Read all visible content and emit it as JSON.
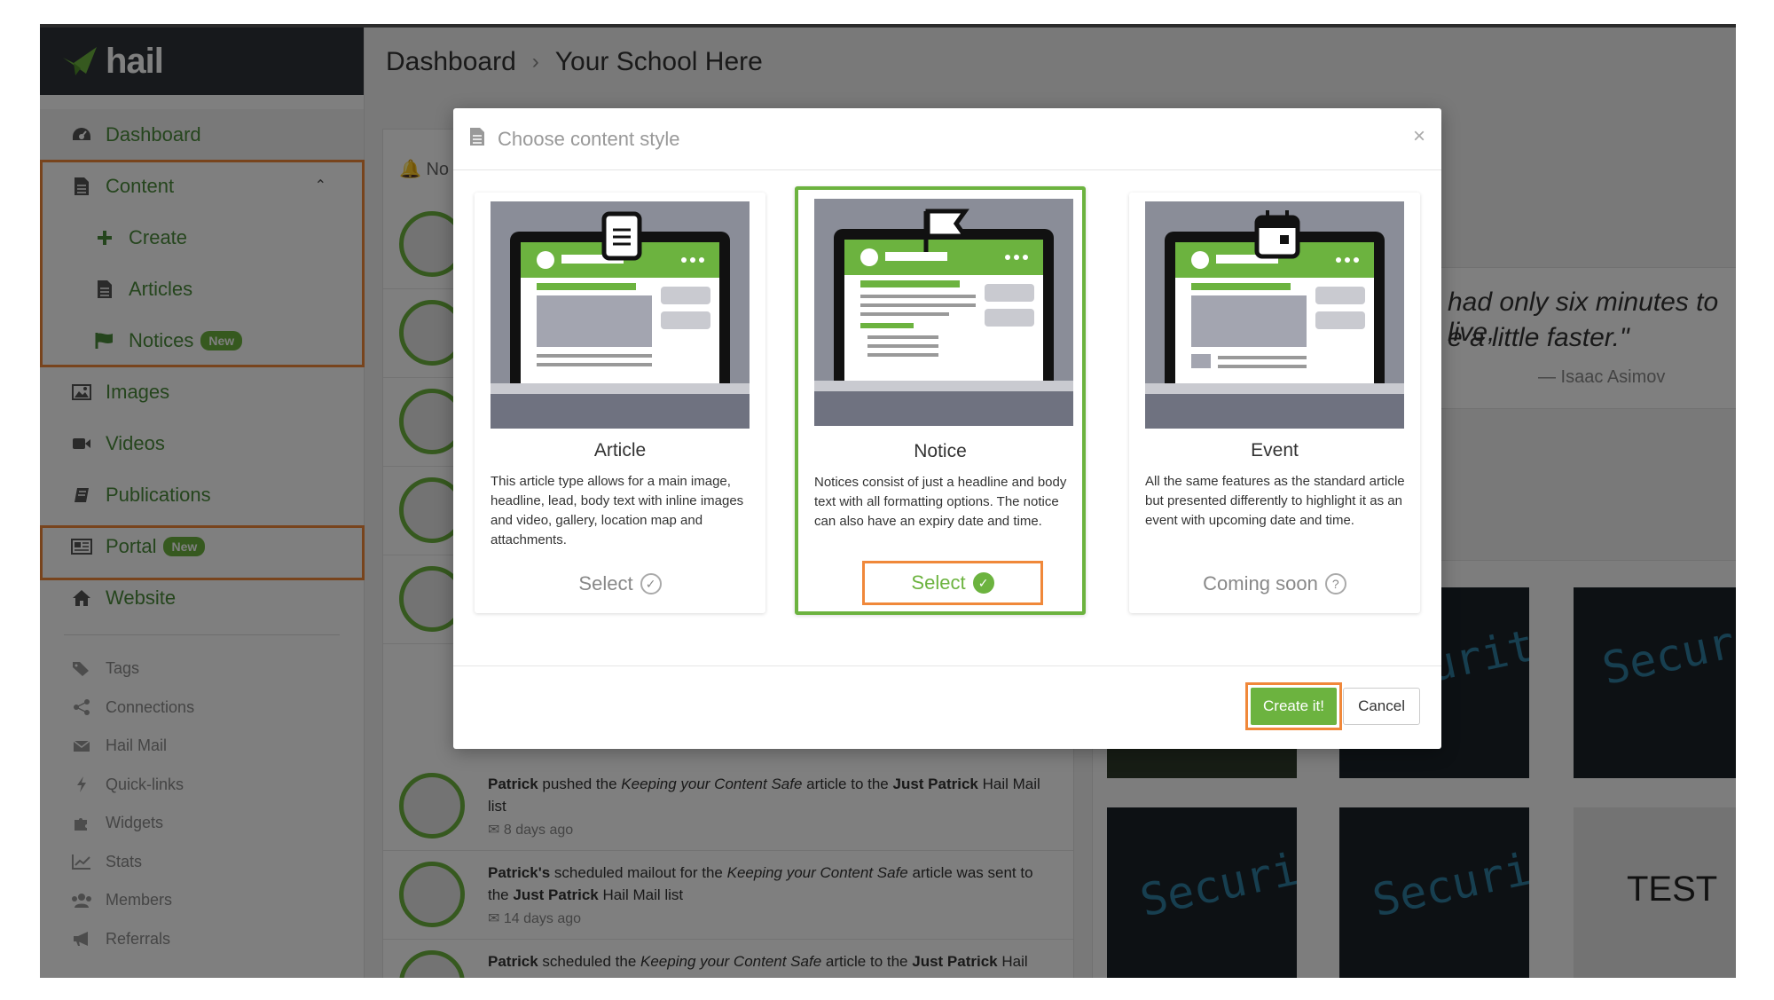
{
  "brand": {
    "name": "hail",
    "accent": "#6cb33f",
    "highlight": "#f0883a"
  },
  "sidebar": {
    "items": [
      {
        "label": "Dashboard",
        "icon": "dashboard-icon"
      },
      {
        "label": "Content",
        "icon": "document-icon"
      },
      {
        "label": "Create",
        "icon": "plus-icon"
      },
      {
        "label": "Articles",
        "icon": "document-icon"
      },
      {
        "label": "Notices",
        "icon": "flag-icon",
        "badge": "New"
      },
      {
        "label": "Images",
        "icon": "image-icon"
      },
      {
        "label": "Videos",
        "icon": "video-icon"
      },
      {
        "label": "Publications",
        "icon": "book-icon"
      },
      {
        "label": "Portal",
        "icon": "newspaper-icon",
        "badge": "New"
      },
      {
        "label": "Website",
        "icon": "home-icon"
      }
    ],
    "secondary": [
      {
        "label": "Tags",
        "icon": "tags-icon"
      },
      {
        "label": "Connections",
        "icon": "share-icon"
      },
      {
        "label": "Hail Mail",
        "icon": "envelope-icon"
      },
      {
        "label": "Quick-links",
        "icon": "bolt-icon"
      },
      {
        "label": "Widgets",
        "icon": "puzzle-icon"
      },
      {
        "label": "Stats",
        "icon": "chart-icon"
      },
      {
        "label": "Members",
        "icon": "users-icon"
      },
      {
        "label": "Referrals",
        "icon": "megaphone-icon"
      }
    ]
  },
  "breadcrumb": {
    "root": "Dashboard",
    "current": "Your School Here"
  },
  "background": {
    "feed_header": "No",
    "quote_line1": "had only six minutes to live,",
    "quote_line2": "e a little faster.\"",
    "quote_author": "— Isaac Asimov",
    "tile_words": [
      "curity",
      "Secur",
      "Security",
      "Security",
      "TEST"
    ],
    "feed": [
      {
        "actor": "Patrick",
        "t1": " pushed the ",
        "em": "Keeping your Content Safe",
        "t2": " article to the ",
        "target": "Just Patrick",
        "t3": " Hail Mail list",
        "time": "8 days ago"
      },
      {
        "actor": "Patrick's",
        "t1": " scheduled mailout for the ",
        "em": "Keeping your Content Safe",
        "t2": " article was sent to the ",
        "target": "Just Patrick",
        "t3": " Hail Mail list",
        "time": "14 days ago"
      },
      {
        "actor": "Patrick",
        "t1": " scheduled the ",
        "em": "Keeping your Content Safe",
        "t2": " article to the ",
        "target": "Just Patrick",
        "t3": " Hail Mail list",
        "time": ""
      }
    ]
  },
  "modal": {
    "title": "Choose content style",
    "close": "×",
    "cards": [
      {
        "title": "Article",
        "desc": "This article type allows for a main image, headline, lead, body text with inline images and video, gallery, location map and attachments.",
        "action": "Select",
        "icon": "document-icon"
      },
      {
        "title": "Notice",
        "desc": "Notices consist of just a headline and body text with all formatting options. The notice can also have an expiry date and time.",
        "action": "Select",
        "icon": "flag-icon"
      },
      {
        "title": "Event",
        "desc": "All the same features as the standard article but presented differently to highlight it as an event with upcoming date and time.",
        "action": "Coming soon",
        "icon": "calendar-icon"
      }
    ],
    "create_label": "Create it!",
    "cancel_label": "Cancel"
  }
}
